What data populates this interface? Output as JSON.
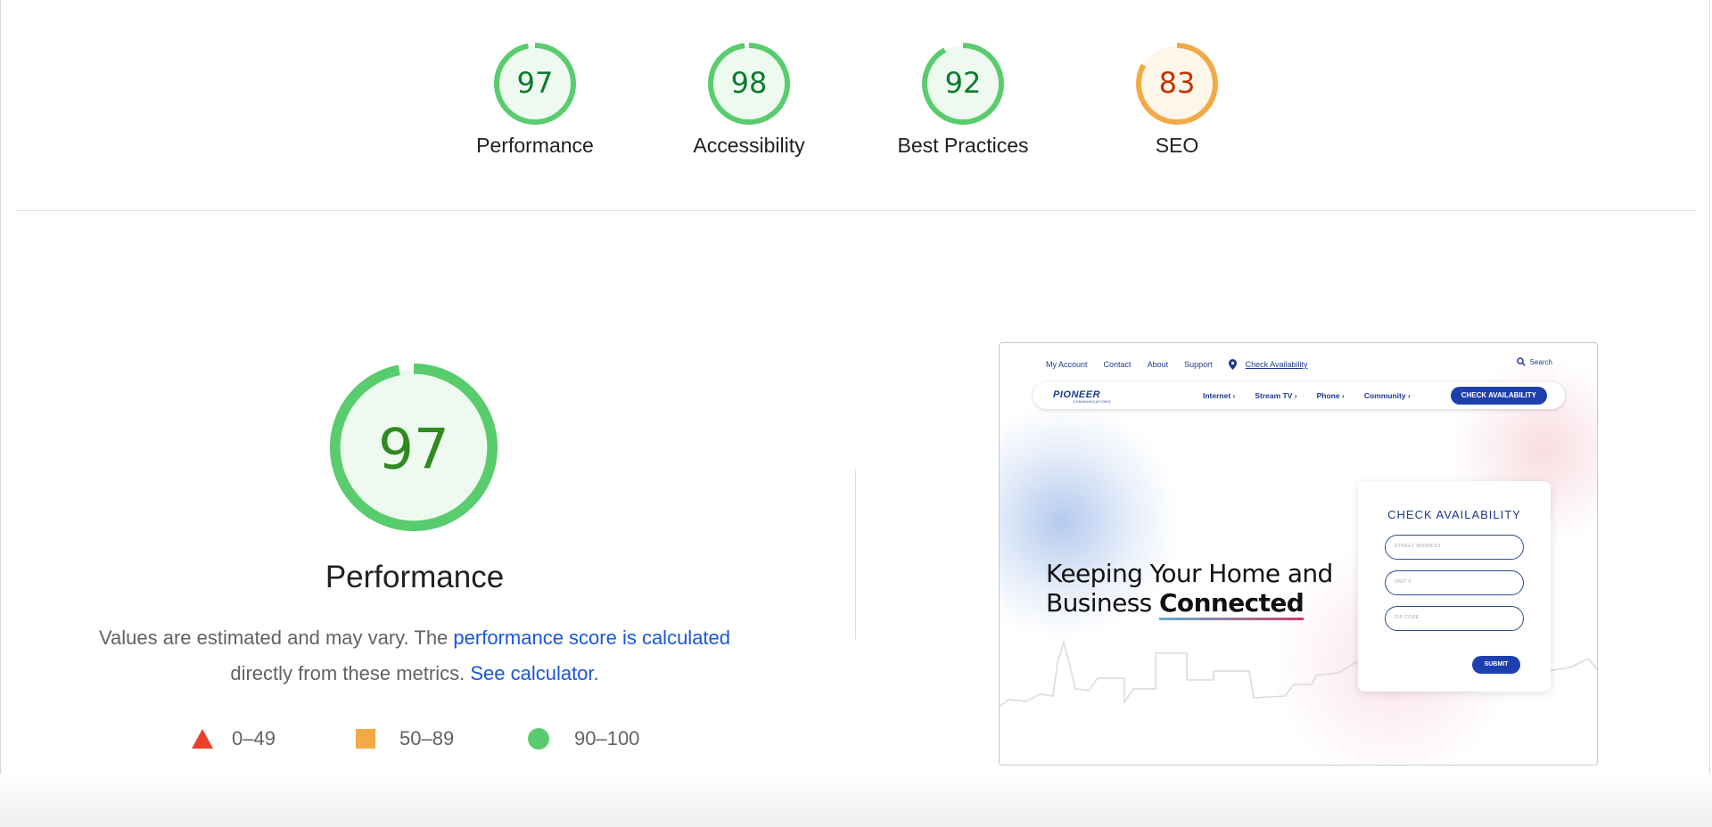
{
  "categories": [
    {
      "label": "Performance",
      "score": "97",
      "fraction": 0.97,
      "color": "#0c7a2e",
      "ring": "#59cc6e",
      "fill": "#eefaf0"
    },
    {
      "label": "Accessibility",
      "score": "98",
      "fraction": 0.98,
      "color": "#0c7a2e",
      "ring": "#59cc6e",
      "fill": "#eefaf0"
    },
    {
      "label": "Best Practices",
      "score": "92",
      "fraction": 0.92,
      "color": "#0c7a2e",
      "ring": "#59cc6e",
      "fill": "#eefaf0"
    },
    {
      "label": "SEO",
      "score": "83",
      "fraction": 0.83,
      "color": "#c33300",
      "ring": "#f2aa46",
      "fill": "#fff6ea"
    }
  ],
  "performance": {
    "score": "97",
    "fraction": 0.97,
    "title": "Performance",
    "desc_prefix": "Values are estimated and may vary. The",
    "link_calc": "performance score is calculated",
    "desc_middle": "directly from these metrics.",
    "link_calculator": "See calculator."
  },
  "legend": [
    {
      "icon": "triangle-icon",
      "range": "0–49",
      "color": "#eb3f2e"
    },
    {
      "icon": "square-icon",
      "range": "50–89",
      "color": "#f2aa46"
    },
    {
      "icon": "circle-icon",
      "range": "90–100",
      "color": "#59cc6e"
    }
  ],
  "screenshot": {
    "topnav": [
      "My Account",
      "Contact",
      "About",
      "Support"
    ],
    "check_availability_link": "Check Availability",
    "search": "Search",
    "logo": "PIONEER",
    "logo_sub": "COMMUNICATIONS",
    "navlinks": [
      "Internet",
      "Stream TV",
      "Phone",
      "Community"
    ],
    "nav_cta": "CHECK AVAILABILITY",
    "hero_line1": "Keeping Your Home and",
    "hero_line2_prefix": "Business",
    "hero_line2_bold": "Connected",
    "card_title": "CHECK AVAILABILITY",
    "fields": [
      "STREET ADDRESS",
      "UNIT #",
      "ZIP CODE"
    ],
    "submit": "SUBMIT"
  }
}
